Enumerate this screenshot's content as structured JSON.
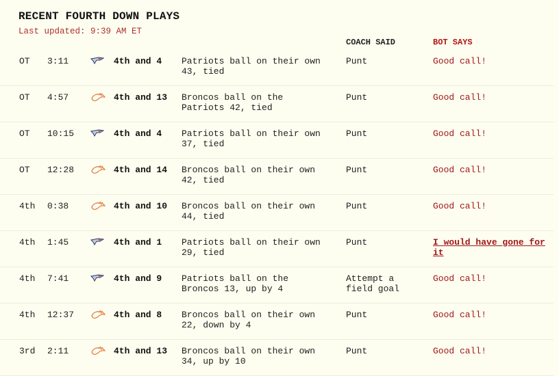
{
  "header": {
    "title": "RECENT FOURTH DOWN PLAYS",
    "updated": "Last updated: 9:39 AM ET"
  },
  "columns": {
    "coach": "COACH SAID",
    "bot": "BOT SAYS"
  },
  "colors": {
    "background": "#fdfdf0",
    "bot_text": "#a01818",
    "patriots_logo": "#2a3a6e",
    "broncos_logo": "#e07a3a"
  },
  "plays": [
    {
      "quarter": "OT",
      "time": "3:11",
      "team_icon": "patriots-logo-icon",
      "down": "4th and 4",
      "situation": "Patriots ball on their own 43, tied",
      "coach": "Punt",
      "bot": "Good call!"
    },
    {
      "quarter": "OT",
      "time": "4:57",
      "team_icon": "broncos-logo-icon",
      "down": "4th and 13",
      "situation": "Broncos ball on the Patriots 42, tied",
      "coach": "Punt",
      "bot": "Good call!"
    },
    {
      "quarter": "OT",
      "time": "10:15",
      "team_icon": "patriots-logo-icon",
      "down": "4th and 4",
      "situation": "Patriots ball on their own 37, tied",
      "coach": "Punt",
      "bot": "Good call!"
    },
    {
      "quarter": "OT",
      "time": "12:28",
      "team_icon": "broncos-logo-icon",
      "down": "4th and 14",
      "situation": "Broncos ball on their own 42, tied",
      "coach": "Punt",
      "bot": "Good call!"
    },
    {
      "quarter": "4th",
      "time": "0:38",
      "team_icon": "broncos-logo-icon",
      "down": "4th and 10",
      "situation": "Broncos ball on their own 44, tied",
      "coach": "Punt",
      "bot": "Good call!"
    },
    {
      "quarter": "4th",
      "time": "1:45",
      "team_icon": "patriots-logo-icon",
      "down": "4th and 1",
      "situation": "Patriots ball on their own 29, tied",
      "coach": "Punt",
      "bot": "I would have gone for it"
    },
    {
      "quarter": "4th",
      "time": "7:41",
      "team_icon": "patriots-logo-icon",
      "down": "4th and 9",
      "situation": "Patriots ball on the Broncos 13, up by 4",
      "coach": "Attempt a field goal",
      "bot": "Good call!"
    },
    {
      "quarter": "4th",
      "time": "12:37",
      "team_icon": "broncos-logo-icon",
      "down": "4th and 8",
      "situation": "Broncos ball on their own 22, down by 4",
      "coach": "Punt",
      "bot": "Good call!"
    },
    {
      "quarter": "3rd",
      "time": "2:11",
      "team_icon": "broncos-logo-icon",
      "down": "4th and 13",
      "situation": "Broncos ball on their own 34, up by 10",
      "coach": "Punt",
      "bot": "Good call!"
    }
  ]
}
